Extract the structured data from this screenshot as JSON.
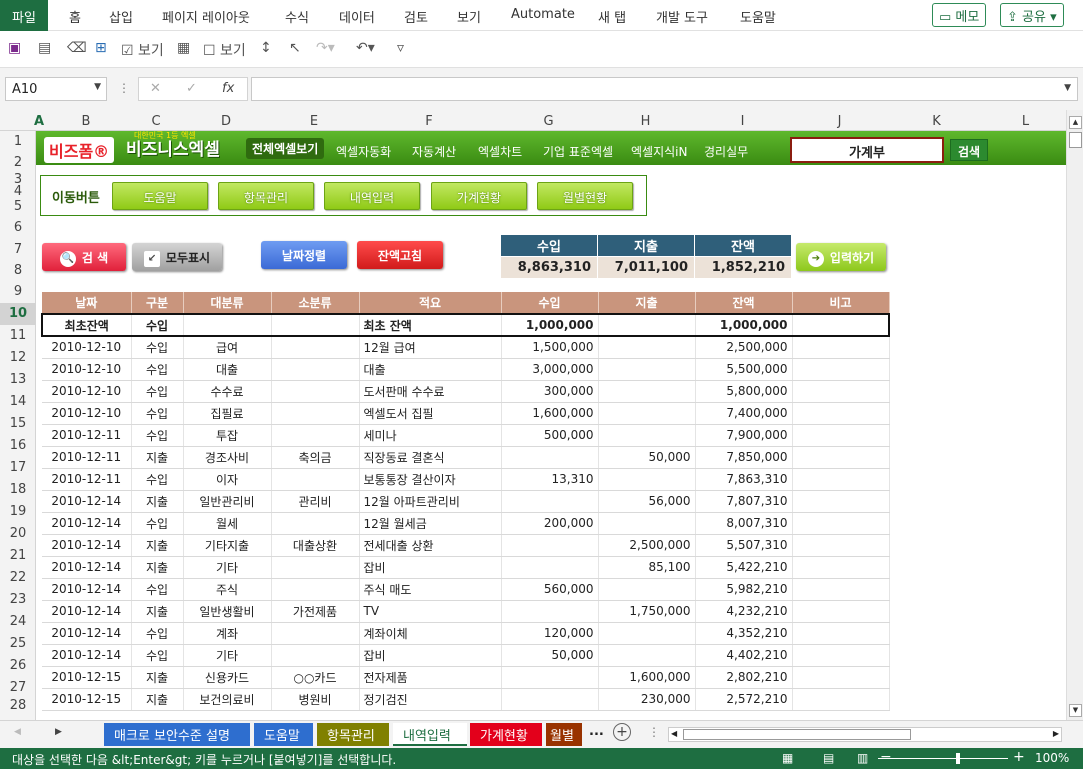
{
  "ribbon": {
    "tabs": [
      "파일",
      "홈",
      "삽입",
      "페이지 레이아웃",
      "수식",
      "데이터",
      "검토",
      "보기",
      "Automate",
      "새 탭",
      "개발 도구",
      "도움말"
    ],
    "memo_button": "메모",
    "share_button": "공유"
  },
  "qat": {
    "view1": "보기",
    "view2": "보기"
  },
  "formula_bar": {
    "name_box": "A10",
    "formula": ""
  },
  "columns": [
    "A",
    "B",
    "C",
    "D",
    "E",
    "F",
    "G",
    "H",
    "I",
    "J",
    "K",
    "L"
  ],
  "rows": [
    "1",
    "2",
    "3",
    "4",
    "5",
    "6",
    "7",
    "8",
    "9",
    "10",
    "11",
    "12",
    "13",
    "14",
    "15",
    "16",
    "17",
    "18",
    "19",
    "20",
    "21",
    "22",
    "23",
    "24",
    "25",
    "26",
    "27",
    "28"
  ],
  "banner": {
    "logo1": "비즈폼®",
    "logo2": "비즈니스엑셀",
    "logo2_tagline": "대한민국 1등 엑셀",
    "nav": [
      "전체엑셀보기",
      "엑셀자동화",
      "자동계산",
      "엑셀차트",
      "기업 표준엑셀",
      "엑셀지식iN",
      "경리실무"
    ],
    "search_value": "가계부",
    "search_button": "검색"
  },
  "move_box": {
    "label": "이동버튼",
    "buttons": [
      "도움말",
      "항목관리",
      "내역입력",
      "가계현황",
      "월별현황"
    ]
  },
  "actions": {
    "search": "검 색",
    "show_all": "모두표시",
    "sort_date": "날짜정렬",
    "fix_balance": "잔액고침",
    "input": "입력하기"
  },
  "summary": {
    "headers": [
      "수입",
      "지출",
      "잔액"
    ],
    "values": [
      "8,863,310",
      "7,011,100",
      "1,852,210"
    ]
  },
  "table": {
    "headers": [
      "날짜",
      "구분",
      "대분류",
      "소분류",
      "적요",
      "수입",
      "지출",
      "잔액",
      "비고"
    ],
    "rows": [
      [
        "최초잔액",
        "수입",
        "",
        "",
        "최초 잔액",
        "1,000,000",
        "",
        "1,000,000",
        ""
      ],
      [
        "2010-12-10",
        "수입",
        "급여",
        "",
        "12월 급여",
        "1,500,000",
        "",
        "2,500,000",
        ""
      ],
      [
        "2010-12-10",
        "수입",
        "대출",
        "",
        "대출",
        "3,000,000",
        "",
        "5,500,000",
        ""
      ],
      [
        "2010-12-10",
        "수입",
        "수수료",
        "",
        "도서판매 수수료",
        "300,000",
        "",
        "5,800,000",
        ""
      ],
      [
        "2010-12-10",
        "수입",
        "집필료",
        "",
        "엑셀도서 집필",
        "1,600,000",
        "",
        "7,400,000",
        ""
      ],
      [
        "2010-12-11",
        "수입",
        "투잡",
        "",
        "세미나",
        "500,000",
        "",
        "7,900,000",
        ""
      ],
      [
        "2010-12-11",
        "지출",
        "경조사비",
        "축의금",
        "직장동료 결혼식",
        "",
        "50,000",
        "7,850,000",
        ""
      ],
      [
        "2010-12-11",
        "수입",
        "이자",
        "",
        "보통통장 결산이자",
        "13,310",
        "",
        "7,863,310",
        ""
      ],
      [
        "2010-12-14",
        "지출",
        "일반관리비",
        "관리비",
        "12월 아파트관리비",
        "",
        "56,000",
        "7,807,310",
        ""
      ],
      [
        "2010-12-14",
        "수입",
        "월세",
        "",
        "12월 월세금",
        "200,000",
        "",
        "8,007,310",
        ""
      ],
      [
        "2010-12-14",
        "지출",
        "기타지출",
        "대출상환",
        "전세대출 상환",
        "",
        "2,500,000",
        "5,507,310",
        ""
      ],
      [
        "2010-12-14",
        "지출",
        "기타",
        "",
        "잡비",
        "",
        "85,100",
        "5,422,210",
        ""
      ],
      [
        "2010-12-14",
        "수입",
        "주식",
        "",
        "주식 매도",
        "560,000",
        "",
        "5,982,210",
        ""
      ],
      [
        "2010-12-14",
        "지출",
        "일반생활비",
        "가전제품",
        "TV",
        "",
        "1,750,000",
        "4,232,210",
        ""
      ],
      [
        "2010-12-14",
        "수입",
        "계좌",
        "",
        "계좌이체",
        "120,000",
        "",
        "4,352,210",
        ""
      ],
      [
        "2010-12-14",
        "수입",
        "기타",
        "",
        "잡비",
        "50,000",
        "",
        "4,402,210",
        ""
      ],
      [
        "2010-12-15",
        "지출",
        "신용카드",
        "○○카드",
        "전자제품",
        "",
        "1,600,000",
        "2,802,210",
        ""
      ],
      [
        "2010-12-15",
        "지출",
        "보건의료비",
        "병원비",
        "정기검진",
        "",
        "230,000",
        "2,572,210",
        ""
      ]
    ]
  },
  "sheet_tabs": [
    "매크로 보안수준 설명",
    "도움말",
    "항목관리",
    "내역입력",
    "가계현황",
    "월별"
  ],
  "sheet_tab_colors": [
    "#2e6ecf",
    "#2e6ecf",
    "#808000",
    "#ffffff",
    "#e3001b",
    "#993300"
  ],
  "sheet_tabs_more": "...",
  "status": {
    "message": "대상을 선택한 다음 &lt;Enter&gt; 키를 누르거나 [붙여넣기]를 선택합니다.",
    "zoom": "100%"
  }
}
